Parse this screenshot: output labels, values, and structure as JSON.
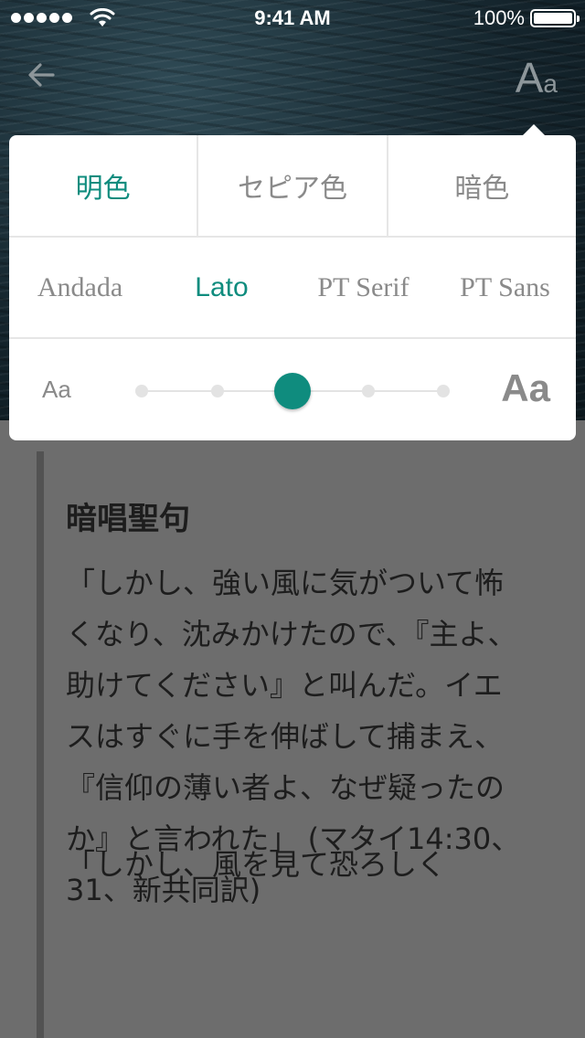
{
  "status_bar": {
    "time": "9:41 AM",
    "battery_percent": "100%",
    "battery_level": 1.0
  },
  "nav": {
    "back_icon": "arrow-left-icon",
    "font_settings": {
      "big": "A",
      "small": "a"
    }
  },
  "settings_panel": {
    "themes": [
      {
        "label": "明色",
        "active": true
      },
      {
        "label": "セピア色",
        "active": false
      },
      {
        "label": "暗色",
        "active": false
      }
    ],
    "fonts": [
      {
        "label": "Andada",
        "active": false
      },
      {
        "label": "Lato",
        "active": true
      },
      {
        "label": "PT Serif",
        "active": false
      },
      {
        "label": "PT Sans",
        "active": false
      }
    ],
    "size": {
      "small_label": "Aa",
      "large_label": "Aa",
      "steps": 5,
      "selected_step": 3
    },
    "accent_color": "#0f8c7e"
  },
  "article": {
    "heading": "暗唱聖句",
    "paragraph1": "「しかし、強い風に気がついて怖くなり、沈みかけたので、『主よ、助けてください』と叫んだ。イエスはすぐに手を伸ばして捕まえ、『信仰の薄い者よ、なぜ疑ったのか』と言われた」 (マタイ14:30、31、新共同訳)",
    "paragraph2": "「しかし、風を見て恐ろしく"
  }
}
